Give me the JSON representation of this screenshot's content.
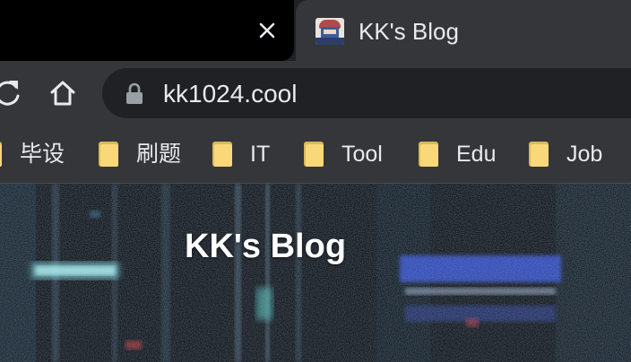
{
  "browser": {
    "tab": {
      "title": "KK's Blog"
    },
    "address_bar": {
      "url": "kk1024.cool"
    },
    "bookmarks": [
      {
        "label": "毕设"
      },
      {
        "label": "刷题"
      },
      {
        "label": "IT"
      },
      {
        "label": "Tool"
      },
      {
        "label": "Edu"
      },
      {
        "label": "Job"
      }
    ]
  },
  "page": {
    "site_title": "KK's Blog"
  },
  "icons": {
    "tab_close": "close-icon",
    "reload": "reload-icon",
    "home": "home-icon",
    "security": "lock-icon",
    "bookmark": "folder-icon"
  },
  "colors": {
    "tabstrip_bg": "#202124",
    "active_tab_bg": "#35363a",
    "omnibox_bg": "#202124",
    "text": "#e8eaed",
    "folder": "#f8d878"
  }
}
